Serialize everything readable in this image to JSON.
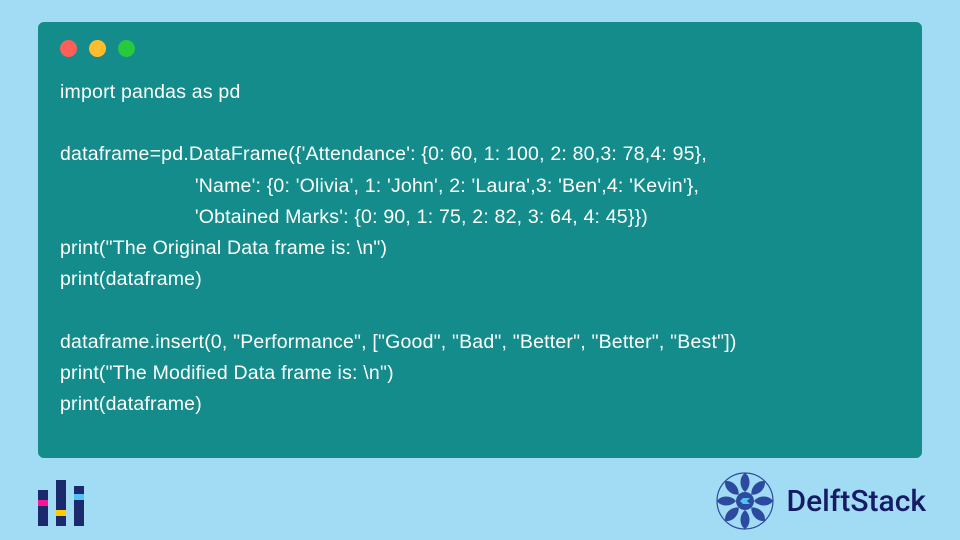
{
  "window": {
    "dotRed": "close",
    "dotYellow": "minimize",
    "dotGreen": "zoom"
  },
  "code": {
    "line1": "import pandas as pd",
    "line2": "",
    "line3": "dataframe=pd.DataFrame({'Attendance': {0: 60, 1: 100, 2: 80,3: 78,4: 95},",
    "line4": "                        'Name': {0: 'Olivia', 1: 'John', 2: 'Laura',3: 'Ben',4: 'Kevin'},",
    "line5": "                        'Obtained Marks': {0: 90, 1: 75, 2: 82, 3: 64, 4: 45}})",
    "line6": "print(\"The Original Data frame is: \\n\")",
    "line7": "print(dataframe)",
    "line8": "",
    "line9": "dataframe.insert(0, \"Performance\", [\"Good\", \"Bad\", \"Better\", \"Better\", \"Best\"])",
    "line10": "print(\"The Modified Data frame is: \\n\")",
    "line11": "print(dataframe)"
  },
  "footer": {
    "leftLogoName": "bars-logo",
    "rightBrand": "DelftStack",
    "rightLogoName": "mandala-logo"
  },
  "colors": {
    "pageBg": "#a2dcf4",
    "windowBg": "#158c8c",
    "codeText": "#ffffff",
    "brandText": "#161b66",
    "brandBlue": "#2b4aa0",
    "brandAccent": "#4fc3f7"
  }
}
